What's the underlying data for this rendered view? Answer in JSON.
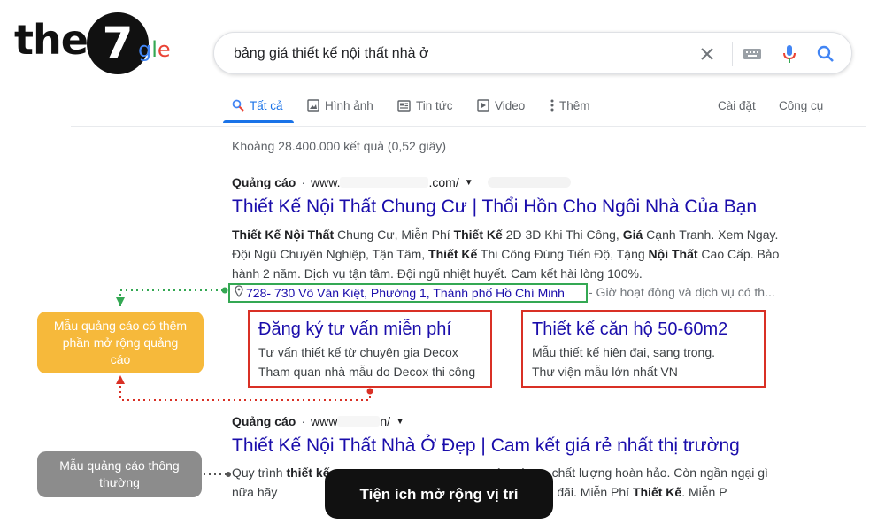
{
  "logo": {
    "text_the": "the",
    "text_seven": "7",
    "text_g": "g",
    "text_l": "l",
    "text_e": "e"
  },
  "search": {
    "query": "bảng giá thiết kế nội thất nhà ở"
  },
  "tabs": {
    "all": "Tất cả",
    "images": "Hình ảnh",
    "news": "Tin tức",
    "video": "Video",
    "more": "Thêm",
    "settings": "Cài đặt",
    "tools": "Công cụ"
  },
  "result_stats": "Khoảng 28.400.000 kết quả (0,52 giây)",
  "ad1": {
    "label": "Quảng cáo",
    "url_prefix": "www.",
    "url_suffix": ".com/",
    "title": "Thiết Kế Nội Thất Chung Cư | Thổi Hồn Cho Ngôi Nhà Của Bạn",
    "desc": {
      "b1": "Thiết Kế Nội Thất",
      "t1": " Chung Cư, Miễn Phí ",
      "b2": "Thiết Kế",
      "t2": " 2D 3D Khi Thi Công, ",
      "b3": "Giá",
      "t3": " Cạnh Tranh. Xem Ngay. Đội Ngũ Chuyên Nghiệp, Tận Tâm, ",
      "b4": "Thiết Kế",
      "t4": " Thi Công Đúng Tiến Độ, Tặng ",
      "b5": "Nội Thất",
      "t5": " Cao Cấp. Bảo hành 2 năm. Dịch vụ tận tâm. Đội ngũ nhiệt huyết. Cam kết hài lòng 100%."
    },
    "location": "728- 730 Võ Văn Kiệt, Phường 1, Thành phố Hồ Chí Minh",
    "location_extra": "- Giờ hoạt động và dịch vụ có th...",
    "sitelinks": [
      {
        "title": "Đăng ký tư vấn miễn phí",
        "line1": "Tư vấn thiết kế từ chuyên gia Decox",
        "line2": "Tham quan nhà mẫu do Decox thi công"
      },
      {
        "title": "Thiết kế căn hộ 50-60m2",
        "line1": "Mẫu thiết kế hiện đại, sang trọng.",
        "line2": "Thư viện mẫu lớn nhất VN"
      }
    ]
  },
  "ad2": {
    "label": "Quảng cáo",
    "url_prefix": "www",
    "url_suffix": "n/",
    "title": "Thiết Kế Nội Thất Nhà Ở Đẹp | Cam kết giá rẻ nhất thị trường",
    "desc": {
      "t1": "Quy trình ",
      "b1": "thiết kế",
      "t2": "                                              ường hcm, chất lượng hoàn hảo. Còn ngần ngại gì nữa hãy                                              ận miễn phí, nhận ưu đãi. Miễn Phí ",
      "b2": "Thiết Kế",
      "t3": ". Miễn P"
    }
  },
  "callouts": {
    "extended": "Mẫu quảng cáo có thêm phần mở rộng quảng cáo",
    "regular": "Mẫu quảng cáo thông thường",
    "location_ext": "Tiện ích mở rộng vị trí"
  },
  "colors": {
    "link_blue": "#1a0dab",
    "tab_blue": "#1a73e8",
    "location_green": "#34a853",
    "sitelink_red": "#d93025",
    "callout_orange": "#f6b93b",
    "callout_gray": "#8c8c8c"
  }
}
